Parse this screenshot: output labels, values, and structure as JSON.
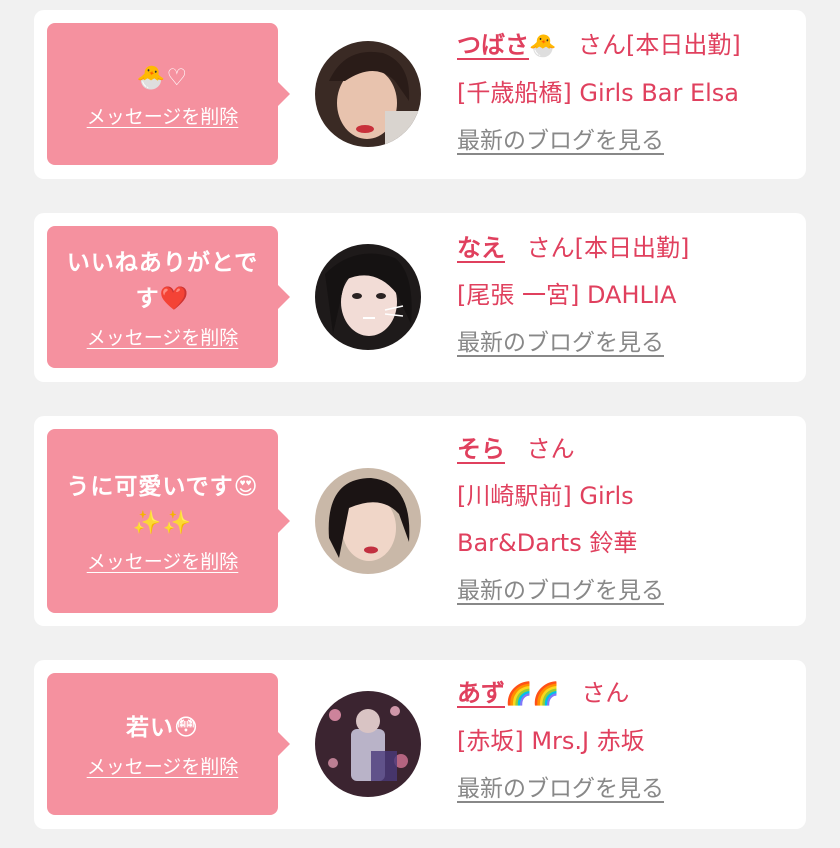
{
  "delete_label": "メッセージを削除",
  "blog_label": "最新のブログを見る",
  "items": [
    {
      "message": "🐣♡",
      "name": "つばさ",
      "name_emoji": "🐣",
      "san": "さん",
      "status": "[本日出勤]",
      "shop": "[千歳船橋] Girls Bar Elsa"
    },
    {
      "message": "いいねありがとです❤️",
      "name": "なえ",
      "name_emoji": "",
      "san": "さん",
      "status": "[本日出勤]",
      "shop": "[尾張 一宮] DAHLIA"
    },
    {
      "message": "うに可愛いです😍✨✨",
      "name": "そら",
      "name_emoji": "",
      "san": "さん",
      "status": "",
      "shop": "[川崎駅前] Girls Bar&Darts 鈴華"
    },
    {
      "message": "若い😳",
      "name": "あず",
      "name_emoji": "🌈🌈",
      "san": "さん",
      "status": "",
      "shop": "[赤坂] Mrs.J 赤坂"
    }
  ]
}
